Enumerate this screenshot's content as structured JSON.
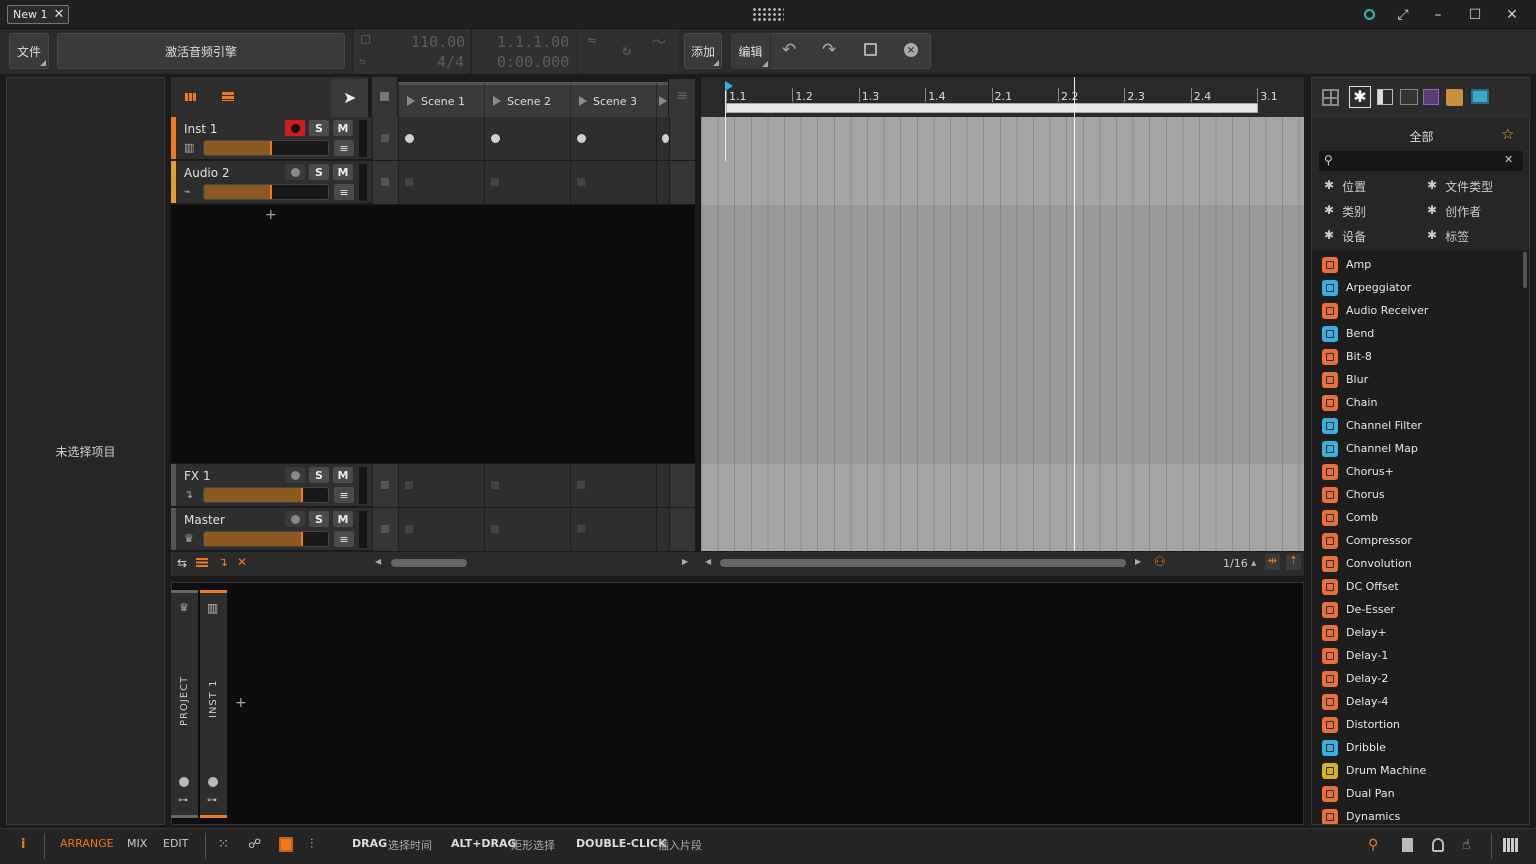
{
  "window": {
    "tab_label": "New 1",
    "tab_close": "✕",
    "minimize": "–",
    "maximize": "☐",
    "close": "✕"
  },
  "toolbar": {
    "file": "文件",
    "activate_audio": "激活音频引擎",
    "tempo": "110.00",
    "time_sig": "4/4",
    "position": "1.1.1.00",
    "time": "0:00.000",
    "add": "添加",
    "edit": "编辑"
  },
  "inspector": {
    "empty": "未选择项目"
  },
  "tracks": [
    {
      "name": "Inst 1",
      "color": "#f07a1a",
      "fader": 0.55,
      "armed": true
    },
    {
      "name": "Audio 2",
      "color": "#e0a22a",
      "fader": 0.55,
      "armed": false
    },
    {
      "name": "FX 1",
      "color": "#777777",
      "fader": 0.8,
      "armed": false
    },
    {
      "name": "Master",
      "color": "#777777",
      "fader": 0.8,
      "armed": false
    }
  ],
  "track_buttons": {
    "solo": "S",
    "mute": "M",
    "menu": "≡",
    "add": "+"
  },
  "scenes": [
    "Scene 1",
    "Scene 2",
    "Scene 3"
  ],
  "ruler": [
    "1.1",
    "1.2",
    "1.3",
    "1.4",
    "2.1",
    "2.2",
    "2.3",
    "2.4",
    "3.1"
  ],
  "grid": "1/16",
  "browser": {
    "title": "全部",
    "filters": [
      {
        "label": "位置"
      },
      {
        "label": "文件类型"
      },
      {
        "label": "类别"
      },
      {
        "label": "创作者"
      },
      {
        "label": "设备"
      },
      {
        "label": "标签"
      }
    ],
    "items": [
      {
        "name": "Amp",
        "kind": "o"
      },
      {
        "name": "Arpeggiator",
        "kind": "b"
      },
      {
        "name": "Audio Receiver",
        "kind": "o"
      },
      {
        "name": "Bend",
        "kind": "b"
      },
      {
        "name": "Bit-8",
        "kind": "o"
      },
      {
        "name": "Blur",
        "kind": "o"
      },
      {
        "name": "Chain",
        "kind": "o"
      },
      {
        "name": "Channel Filter",
        "kind": "b"
      },
      {
        "name": "Channel Map",
        "kind": "b"
      },
      {
        "name": "Chorus+",
        "kind": "o"
      },
      {
        "name": "Chorus",
        "kind": "o"
      },
      {
        "name": "Comb",
        "kind": "o"
      },
      {
        "name": "Compressor",
        "kind": "o"
      },
      {
        "name": "Convolution",
        "kind": "o"
      },
      {
        "name": "DC Offset",
        "kind": "o"
      },
      {
        "name": "De-Esser",
        "kind": "o"
      },
      {
        "name": "Delay+",
        "kind": "o"
      },
      {
        "name": "Delay-1",
        "kind": "o"
      },
      {
        "name": "Delay-2",
        "kind": "o"
      },
      {
        "name": "Delay-4",
        "kind": "o"
      },
      {
        "name": "Distortion",
        "kind": "o"
      },
      {
        "name": "Dribble",
        "kind": "b"
      },
      {
        "name": "Drum Machine",
        "kind": "y"
      },
      {
        "name": "Dual Pan",
        "kind": "o"
      },
      {
        "name": "Dynamics",
        "kind": "o"
      }
    ]
  },
  "device_panel": {
    "project": "PROJECT",
    "inst": "INST 1",
    "add": "+"
  },
  "status": {
    "info": "i",
    "arrange": "ARRANGE",
    "mix": "MIX",
    "edit": "EDIT",
    "drag_key": "DRAG",
    "drag_val": "选择时间",
    "altdrag_key": "ALT+DRAG",
    "altdrag_val": "矩形选择",
    "dbl_key": "DOUBLE-CLICK",
    "dbl_val": "插入片段"
  }
}
